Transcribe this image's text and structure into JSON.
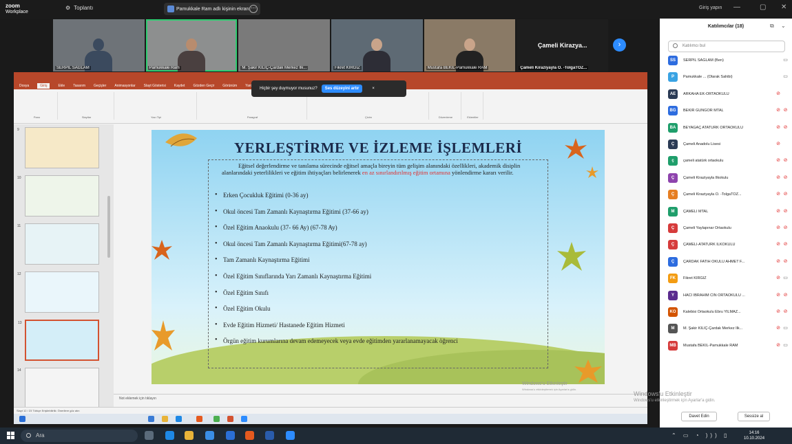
{
  "zoom": {
    "logo_line1": "zoom",
    "logo_line2": "Workplace",
    "meetings_label": "Toplantı",
    "share_label": "Pamukkale Ram adlı kişinin ekranı",
    "signin_label": "Giriş yapın",
    "next_arrow": "›"
  },
  "videos": [
    {
      "label": "SERPİL SAĞLAM"
    },
    {
      "label": "Pamukkale Ram"
    },
    {
      "label": "M. Şakir KILIÇ-Çardak Merkez İlk..."
    },
    {
      "label": "Fikret KIRGIZ"
    },
    {
      "label": "Mustafa BEKİL-Pamukkale RAM"
    },
    {
      "label": "Çameli Kiraziyayla O. -TolgaTOZ...",
      "center_name": "Çameli Kirazya..."
    }
  ],
  "powerpoint": {
    "tabs": [
      "Dosya",
      "Giriş",
      "Ekle",
      "Tasarım",
      "Geçişler",
      "Animasyonlar",
      "Slayt Gösterisi",
      "Kaydet",
      "Gözden Geçir",
      "Görünüm",
      "Yardım"
    ],
    "selected_tab": "Giriş",
    "tooltip_text": "Hiçbir şey duymuyor musunuz?",
    "tooltip_button": "Ses düzeyini artır",
    "tooltip_close": "×",
    "ribbon_groups": [
      "Pano",
      "Slaytlar",
      "Yazı Tipi",
      "Paragraf",
      "Çizim",
      "Düzenleme",
      "Eklentiler"
    ],
    "notes_placeholder": "Not eklemek için tıklayın",
    "status_text": "Slayt 12 / 23   Türkçe   Erişilebilirlik: Önerilere göz atın",
    "watermark_line1": "Windows'u Etkinleştir",
    "watermark_line2": "Windows'u etkinleştirmek için Ayarlar'a gidin."
  },
  "thumbnails": [
    {
      "num": "9"
    },
    {
      "num": "10"
    },
    {
      "num": "11"
    },
    {
      "num": "12"
    },
    {
      "num": "13"
    },
    {
      "num": "14"
    }
  ],
  "slide": {
    "title": "YERLEŞTİRME VE İZLEME İŞLEMLERİ",
    "intro_before": "Eğitsel değerlendirme ve tanılama sürecinde eğitsel amaçla bireyin tüm gelişim alanındaki özellikleri, akademik disiplin alanlarındaki yeterlilikleri ve eğitim ihtiyaçları belirlenerek ",
    "intro_highlight": "en az sınırlandırılmış eğitim ortamına",
    "intro_after": " yönlendirme kararı verilir.",
    "items": [
      "Erken Çocukluk Eğitimi (0-36 ay)",
      "Okul öncesi Tam Zamanlı Kaynaştırma Eğitimi (37-66 ay)",
      "Özel Eğitim Anaokulu (37- 66 Ay) (67-78 Ay)",
      "Okul öncesi Tam Zamanlı Kaynaştırma Eğitimi(67-78 ay)",
      "Tam Zamanlı Kaynaştırma Eğitimi",
      "Özel Eğitim Sınıflarında Yarı Zamanlı Kaynaştırma Eğitimi",
      "Özel Eğitim Sınıfı",
      "Özel Eğitim Okulu",
      "Evde Eğitim Hizmeti/ Hastanede Eğitim Hizmeti",
      "Örgün eğitim kurumlarına devam edemeyecek  veya evde eğitimden yararlanamayacak öğrenci"
    ]
  },
  "participants": {
    "title": "Katılımcılar (18)",
    "search_placeholder": "Katılımcı bul",
    "list": [
      {
        "initials": "SS",
        "color": "#2d6cdf",
        "name": "SERPİL SAĞLAM (Ben)",
        "mic": "",
        "cam": "▭"
      },
      {
        "initials": "P",
        "color": "#3aa3e3",
        "name": "Pamukkale ...   (Olarak Sahibi)",
        "mic": "",
        "cam": "▭"
      },
      {
        "initials": "AE",
        "color": "#2b3b55",
        "name": "ARKAHA EK-ORTAOKULU",
        "mic": "⊘",
        "cam": ""
      },
      {
        "initials": "BG",
        "color": "#2d6cdf",
        "name": "BEKİR GÜNGÖR MTAL",
        "mic": "⊘",
        "cam": "⊘"
      },
      {
        "initials": "BA",
        "color": "#1f9e6b",
        "name": "BEYAĞAÇ ATATÜRK ORTAOKULU",
        "mic": "⊘",
        "cam": "⊘"
      },
      {
        "initials": "Ç",
        "color": "#2b3b55",
        "name": "Çameli Anadolu Lisesi",
        "mic": "⊘",
        "cam": ""
      },
      {
        "initials": "ç",
        "color": "#1f9e6b",
        "name": "çameli atatürk ortaokulu",
        "mic": "⊘",
        "cam": "⊘"
      },
      {
        "initials": "Ç",
        "color": "#8e44ad",
        "name": "Çameli Kiraziyayla İlkokulu",
        "mic": "⊘",
        "cam": "⊘"
      },
      {
        "initials": "Ç",
        "color": "#e67e22",
        "name": "Çameli Kiraziyayla O. -TolgaTOZ...",
        "mic": "⊘",
        "cam": "⊘"
      },
      {
        "initials": "M",
        "color": "#1f9e6b",
        "name": "ÇAMELİ MTAL",
        "mic": "⊘",
        "cam": "⊘"
      },
      {
        "initials": "Ç",
        "color": "#d63b3b",
        "name": "Çameli Yaylapınar Ortaokulu",
        "mic": "⊘",
        "cam": "⊘"
      },
      {
        "initials": "Ç",
        "color": "#d63b3b",
        "name": "ÇAMELİ-ATATÜRK İLKOKULU",
        "mic": "⊘",
        "cam": "⊘"
      },
      {
        "initials": "Ç",
        "color": "#2d6cdf",
        "name": "ÇARDAK FATİH OKULU AHMET F...",
        "mic": "⊘",
        "cam": "⊘"
      },
      {
        "initials": "FK",
        "color": "#f39c12",
        "name": "Fikret KIRGIZ",
        "mic": "⊘",
        "cam": "▭"
      },
      {
        "initials": "Y",
        "color": "#5b2c8e",
        "name": "HACI İBRAHİM CİN ORTAOKULU ...",
        "mic": "⊘",
        "cam": "⊘"
      },
      {
        "initials": "KO",
        "color": "#d35400",
        "name": "Kalebisi Ortaokulu Ebru YILMAZ...",
        "mic": "⊘",
        "cam": "⊘"
      },
      {
        "initials": "M",
        "color": "#555",
        "name": "M. Şakir KILIÇ-Çardak Merkez İlk...",
        "mic": "⊘",
        "cam": "▭"
      },
      {
        "initials": "MB",
        "color": "#d63b3b",
        "name": "Mustafa BEKİL-Pamukkale RAM",
        "mic": "⊘",
        "cam": "▭"
      }
    ],
    "invite_label": "Davet Edin",
    "mute_label": "Sessize al",
    "watermark_line1": "Windows'u Etkinleştir",
    "watermark_line2": "Windows'u etkinleştirmek için Ayarlar'a gidin."
  },
  "taskbar": {
    "search_label": "Ara",
    "time": "14:16",
    "date": "10.10.2024",
    "sys": "⌃ ▭ ◔ ))) ▯"
  },
  "colors": {
    "ppt_red": "#b7472a",
    "zoom_blue": "#2d8cff",
    "active_tile": "#2ecc71"
  }
}
